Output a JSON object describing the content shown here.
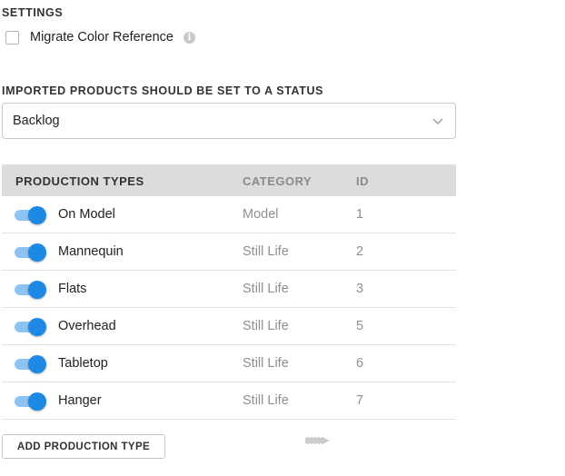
{
  "settings": {
    "title": "SETTINGS",
    "migrate_color_label": "Migrate Color Reference",
    "migrate_color_checked": false,
    "info_glyph": "i"
  },
  "status": {
    "title": "IMPORTED PRODUCTS SHOULD BE SET TO A STATUS",
    "selected": "Backlog"
  },
  "table": {
    "headers": {
      "type": "PRODUCTION TYPES",
      "category": "CATEGORY",
      "id": "ID"
    },
    "rows": [
      {
        "name": "On Model",
        "category": "Model",
        "id": "1",
        "enabled": true
      },
      {
        "name": "Mannequin",
        "category": "Still Life",
        "id": "2",
        "enabled": true
      },
      {
        "name": "Flats",
        "category": "Still Life",
        "id": "3",
        "enabled": true
      },
      {
        "name": "Overhead",
        "category": "Still Life",
        "id": "5",
        "enabled": true
      },
      {
        "name": "Tabletop",
        "category": "Still Life",
        "id": "6",
        "enabled": true
      },
      {
        "name": "Hanger",
        "category": "Still Life",
        "id": "7",
        "enabled": true
      }
    ]
  },
  "add_button_label": "ADD PRODUCTION TYPE",
  "colors": {
    "toggle_on": "#1e88e5",
    "toggle_track": "#8cc3f3",
    "header_bg": "#dcdcdc"
  }
}
